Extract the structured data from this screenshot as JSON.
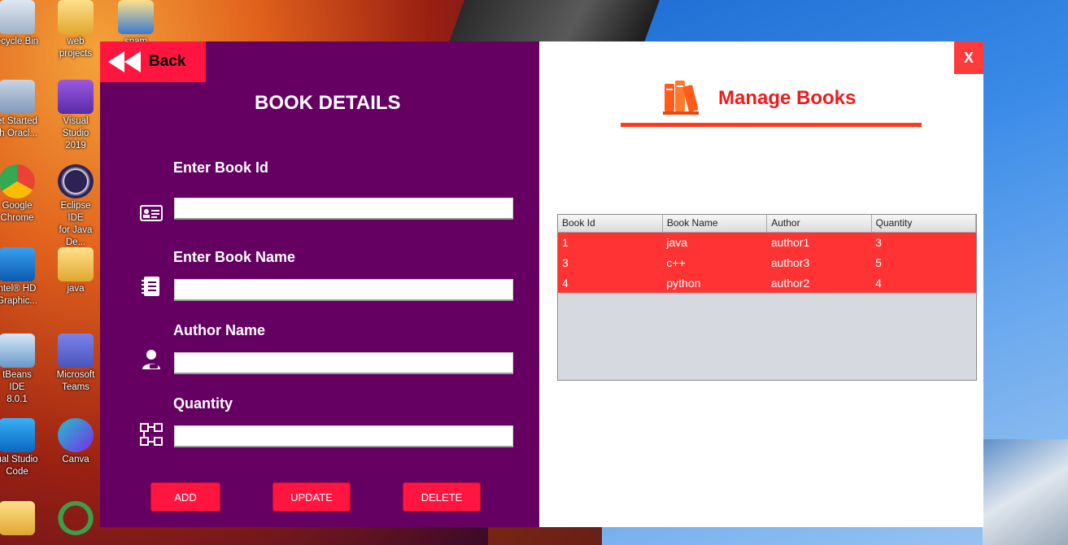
{
  "desktop": {
    "icons": [
      {
        "label": "ecycle Bin"
      },
      {
        "label": "web projects"
      },
      {
        "label": "spam"
      },
      {
        "label": "et Started\nth Oracl..."
      },
      {
        "label": "Visual Studio\n2019"
      },
      {
        "label": "Google\nChrome"
      },
      {
        "label": "Eclipse IDE\nfor Java De..."
      },
      {
        "label": "ntel® HD\nGraphic..."
      },
      {
        "label": "java"
      },
      {
        "label": "tBeans IDE\n8.0.1"
      },
      {
        "label": "Microsoft\nTeams"
      },
      {
        "label": "ual Studio\nCode"
      },
      {
        "label": "Canva"
      }
    ]
  },
  "left_panel": {
    "back_label": "Back",
    "title": "BOOK DETAILS",
    "fields": [
      {
        "label": "Enter Book Id",
        "value": "",
        "icon": "id-card-icon"
      },
      {
        "label": "Enter Book Name",
        "value": "",
        "icon": "notebook-icon"
      },
      {
        "label": "Author Name",
        "value": "",
        "icon": "person-icon"
      },
      {
        "label": "Quantity",
        "value": "",
        "icon": "network-icon"
      }
    ],
    "buttons": {
      "add": "ADD",
      "update": "UPDATE",
      "delete": "DELETE"
    }
  },
  "right_panel": {
    "close_label": "X",
    "title": "Manage Books",
    "table": {
      "headers": [
        "Book Id",
        "Book Name",
        "Author",
        "Quantity"
      ],
      "rows": [
        [
          "1",
          "java",
          "author1",
          "3"
        ],
        [
          "3",
          "c++",
          "author3",
          "5"
        ],
        [
          "4",
          "python",
          "author2",
          "4"
        ]
      ]
    }
  },
  "colors": {
    "left_bg": "#650062",
    "accent_red": "#ff1640",
    "row_red": "#ff3333",
    "title_red": "#ee1c1c"
  }
}
